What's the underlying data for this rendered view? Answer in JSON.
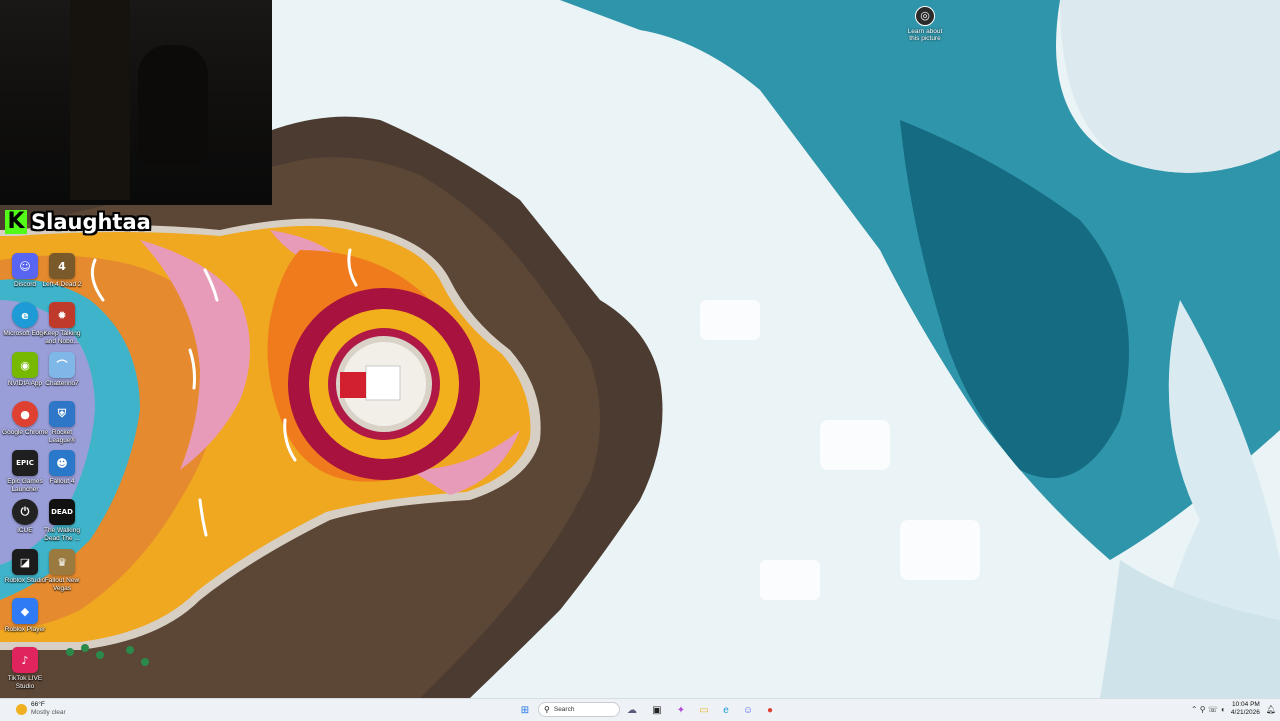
{
  "overlay": {
    "channel_name": "Slaughtaa",
    "platform_logo_letter": "K",
    "platform_color": "#53fc18"
  },
  "desktop": {
    "learn_more": {
      "label": "Learn about this picture",
      "icon": "camera-icon"
    },
    "icons": [
      {
        "name": "discord",
        "label": "Discord",
        "glyph": "☺",
        "color": "#5865f2"
      },
      {
        "name": "left4dead2",
        "label": "Left 4 Dead 2",
        "glyph": "4",
        "color": "#7a5a2a"
      },
      {
        "name": "edge",
        "label": "Microsoft Edge",
        "glyph": "e",
        "color": "#1d9bd6"
      },
      {
        "name": "keeptalking",
        "label": "Keep Talking and Nobo...",
        "glyph": "✹",
        "color": "#c03a2b"
      },
      {
        "name": "nvidia",
        "label": "NVIDIA App",
        "glyph": "◉",
        "color": "#76b900"
      },
      {
        "name": "chatterino",
        "label": "Chatterino7",
        "glyph": "⌒",
        "color": "#7fb8e8"
      },
      {
        "name": "chrome",
        "label": "Google Chrome",
        "glyph": "●",
        "color": "#de4032"
      },
      {
        "name": "rocketleague",
        "label": "Rocket League®",
        "glyph": "⛨",
        "color": "#2d76c8"
      },
      {
        "name": "epic",
        "label": "Epic Games Launcher",
        "glyph": "EPIC",
        "color": "#1f1f1f"
      },
      {
        "name": "fallout4",
        "label": "Fallout 4",
        "glyph": "☻",
        "color": "#2a78c9"
      },
      {
        "name": "icue",
        "label": "iCUE",
        "glyph": "⏻",
        "color": "#222222"
      },
      {
        "name": "walkingdead",
        "label": "The Walking Dead The ...",
        "glyph": "DEAD",
        "color": "#111111"
      },
      {
        "name": "robloxstudio",
        "label": "Roblox Studio",
        "glyph": "◪",
        "color": "#1c1c1c"
      },
      {
        "name": "falloutnv",
        "label": "Fallout New Vegas",
        "glyph": "♛",
        "color": "#9a7a3e"
      },
      {
        "name": "robloxplayer",
        "label": "Roblox Player",
        "glyph": "◆",
        "color": "#2f7bf5"
      },
      {
        "name": "tiktoklive",
        "label": "TikTok LIVE Studio",
        "glyph": "♪",
        "color": "#e0245e"
      }
    ]
  },
  "taskbar": {
    "weather": {
      "temp": "66°F",
      "condition": "Mostly clear"
    },
    "search_placeholder": "Search",
    "pinned": [
      {
        "name": "start",
        "glyph": "⊞",
        "color": "#1a73e8"
      },
      {
        "name": "widgets",
        "glyph": "☁",
        "color": "#5a5a7a"
      },
      {
        "name": "task-view",
        "glyph": "▣",
        "color": "#222222"
      },
      {
        "name": "copilot",
        "glyph": "✦",
        "color": "#b04cd8"
      },
      {
        "name": "file-explorer",
        "glyph": "▭",
        "color": "#e8b12a"
      },
      {
        "name": "edge",
        "glyph": "e",
        "color": "#1d9bd6"
      },
      {
        "name": "discord",
        "glyph": "☺",
        "color": "#5865f2"
      },
      {
        "name": "chrome",
        "glyph": "●",
        "color": "#de4032"
      }
    ],
    "clock": {
      "time": "10:04 PM",
      "date": "4/21/2026"
    },
    "tray_glyphs": "⌃  ⚲  ☏  ◖"
  }
}
